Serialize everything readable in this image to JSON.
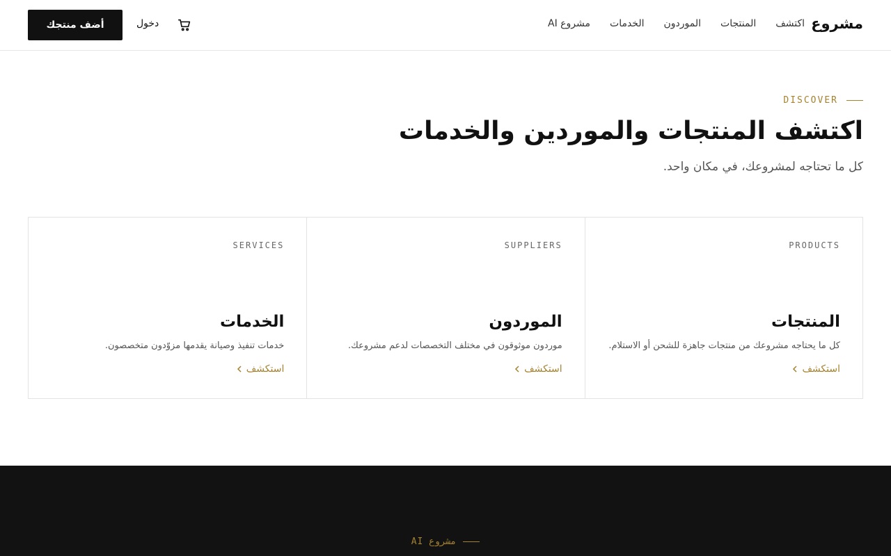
{
  "header": {
    "brand": "مشروع",
    "nav": [
      {
        "label": "اكتشف"
      },
      {
        "label": "المنتجات"
      },
      {
        "label": "الموردون"
      },
      {
        "label": "الخدمات"
      },
      {
        "label": "مشروع AI"
      }
    ],
    "cart_icon": "cart-icon",
    "login_label": "دخول",
    "add_button_label": "أضف منتجك"
  },
  "hero": {
    "eyebrow": "DISCOVER",
    "title": "اكتشف المنتجات والموردين والخدمات",
    "subtitle": "كل ما تحتاجه لمشروعك، في مكان واحد."
  },
  "cards": [
    {
      "tag": "PRODUCTS",
      "title": "المنتجات",
      "description": "كل ما يحتاجه مشروعك من منتجات جاهزة للشحن أو الاستلام.",
      "link": "استكشف"
    },
    {
      "tag": "SUPPLIERS",
      "title": "الموردون",
      "description": "موردون موثوقون في مختلف التخصصات لدعم مشروعك.",
      "link": "استكشف"
    },
    {
      "tag": "SERVICES",
      "title": "الخدمات",
      "description": "خدمات تنفيذ وصيانة يقدمها مزوّدون متخصصون.",
      "link": "استكشف"
    }
  ],
  "footer": {
    "eyebrow": "مشروع AI"
  },
  "colors": {
    "accent": "#a6822f",
    "dark": "#111111",
    "footer_bg": "#121212",
    "border": "#e3e3e3"
  }
}
